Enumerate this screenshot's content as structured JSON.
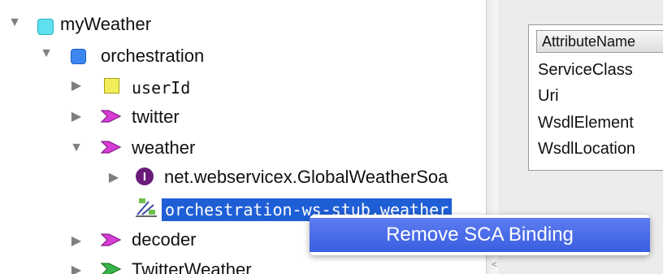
{
  "tree": {
    "root": {
      "label": "myWeather"
    },
    "orchestration": {
      "label": "orchestration"
    },
    "userId": {
      "label": "userId"
    },
    "twitter": {
      "label": "twitter"
    },
    "weather": {
      "label": "weather"
    },
    "interface": {
      "label": "net.webservicex.GlobalWeatherSoa",
      "badge": "I"
    },
    "binding": {
      "label": "orchestration-ws-stub.weather"
    },
    "decoder": {
      "label": "decoder"
    },
    "twitterWeather": {
      "label": "TwitterWeather"
    }
  },
  "properties": {
    "header": "AttributeName",
    "rows": [
      "ServiceClass",
      "Uri",
      "WsdlElement",
      "WsdlLocation"
    ]
  },
  "context_menu": {
    "item": "Remove SCA Binding"
  },
  "colors": {
    "selection": "#1f5fd6",
    "menu_highlight": "#3a5ee0",
    "cyan_node": "#5fe0ef",
    "blue_node": "#3c86f0",
    "yellow_node": "#f2ee5a",
    "magenta_node": "#cc33cc",
    "green_node": "#39b54a"
  }
}
